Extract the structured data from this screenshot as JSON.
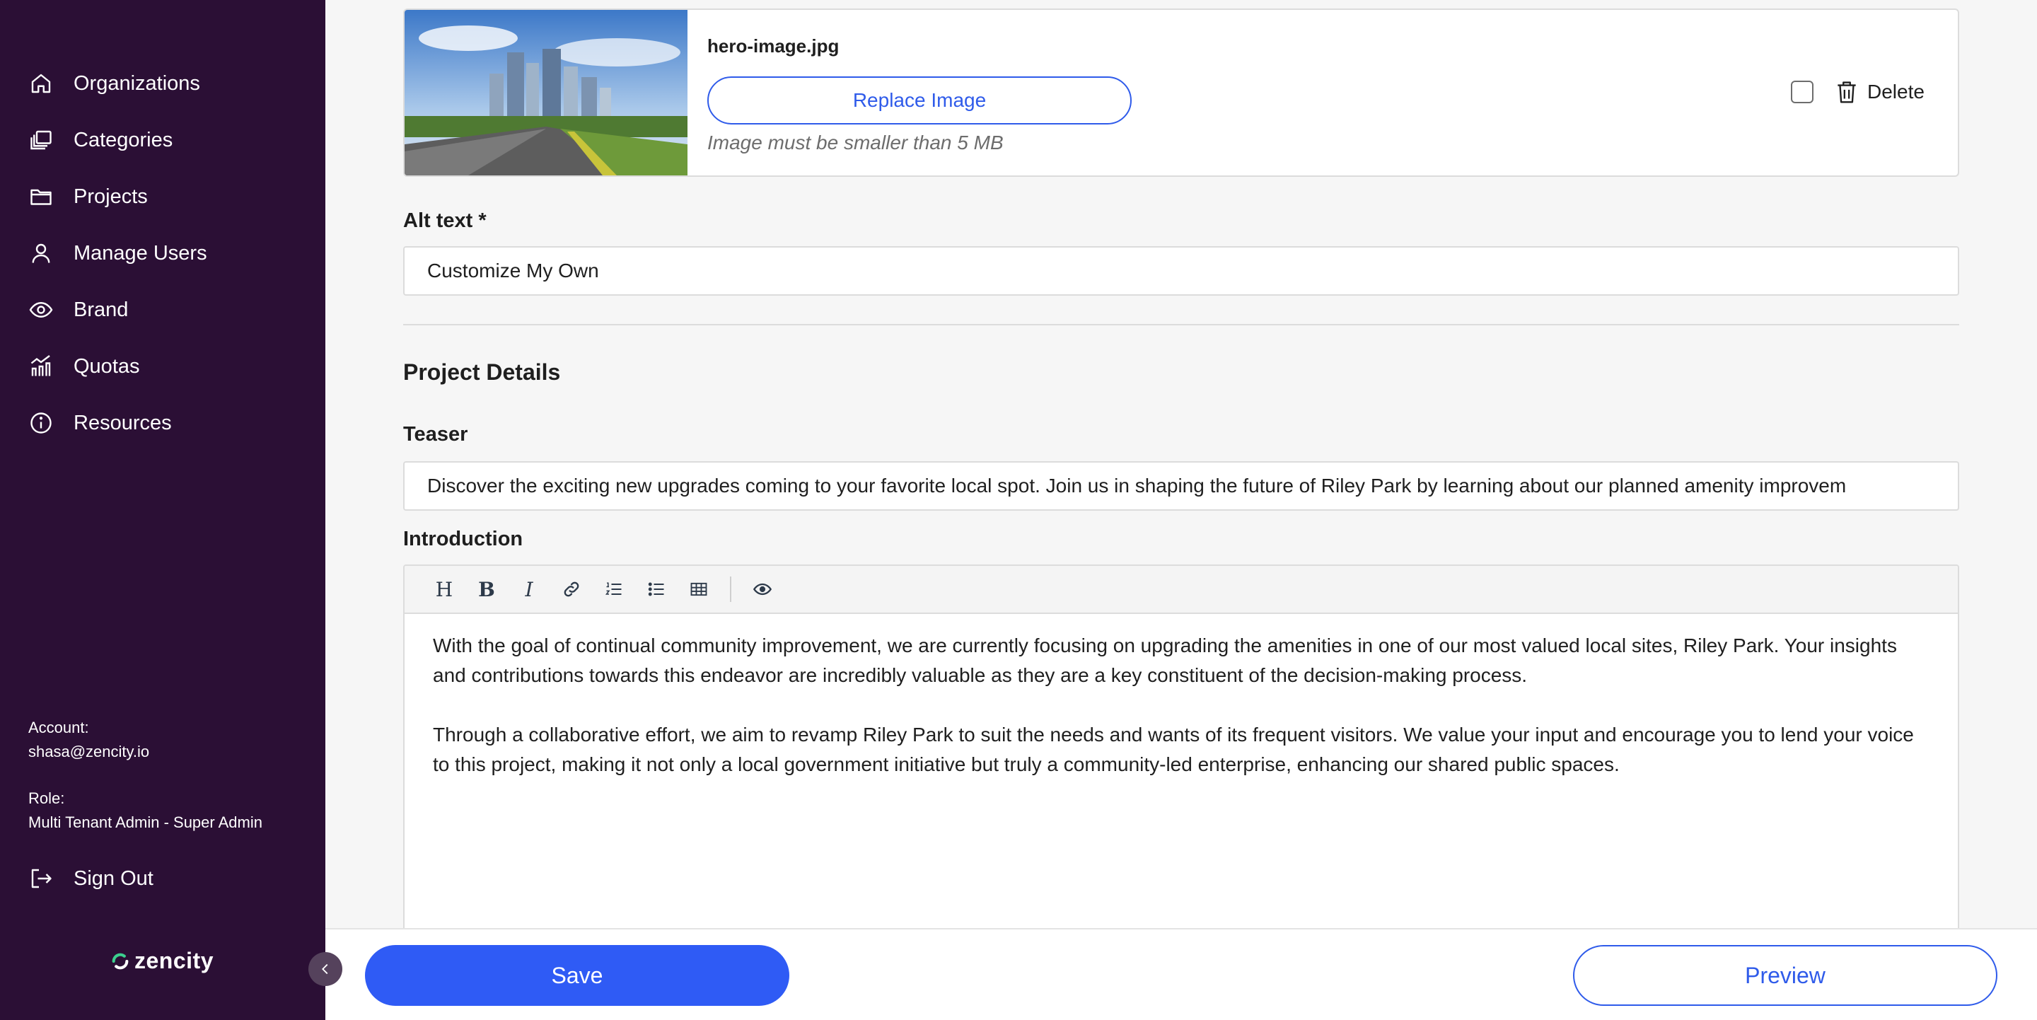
{
  "sidebar": {
    "items": [
      {
        "label": "Organizations",
        "icon": "home-icon"
      },
      {
        "label": "Categories",
        "icon": "stack-icon"
      },
      {
        "label": "Projects",
        "icon": "folder-icon"
      },
      {
        "label": "Manage Users",
        "icon": "user-icon"
      },
      {
        "label": "Brand",
        "icon": "eye-icon"
      },
      {
        "label": "Quotas",
        "icon": "bar-chart-icon"
      },
      {
        "label": "Resources",
        "icon": "info-icon"
      }
    ],
    "account_label": "Account:",
    "account_value": "shasa@zencity.io",
    "role_label": "Role:",
    "role_value": "Multi Tenant Admin - Super Admin",
    "sign_out": "Sign Out",
    "logo_text": "zencity"
  },
  "image": {
    "filename": "hero-image.jpg",
    "replace_label": "Replace Image",
    "hint": "Image must be smaller than 5 MB",
    "delete_label": "Delete"
  },
  "alt_text": {
    "label": "Alt text *",
    "value": "Customize My Own"
  },
  "project_details": {
    "title": "Project Details",
    "teaser_label": "Teaser",
    "teaser_value": "Discover the exciting new upgrades coming to your favorite local spot. Join us in shaping the future of Riley Park by learning about our planned amenity improvem",
    "intro_label": "Introduction",
    "intro_paragraphs": [
      "With the goal of continual community improvement, we are currently focusing on upgrading the amenities in one of our most valued local sites, Riley Park. Your insights and contributions towards this endeavor are incredibly valuable as they are a key constituent of the decision-making process.",
      "Through a collaborative effort, we aim to revamp Riley Park to suit the needs and wants of its frequent visitors. We value your input and encourage you to lend your voice to this project, making it not only a local government initiative but truly a community-led enterprise, enhancing our shared public spaces."
    ]
  },
  "toolbar": {
    "heading": "H",
    "bold": "B",
    "italic": "I"
  },
  "footer": {
    "save_label": "Save",
    "preview_label": "Preview"
  },
  "colors": {
    "sidebar_bg": "#2b0f35",
    "primary": "#2f5bf5",
    "page_bg": "#f6f6f6"
  }
}
